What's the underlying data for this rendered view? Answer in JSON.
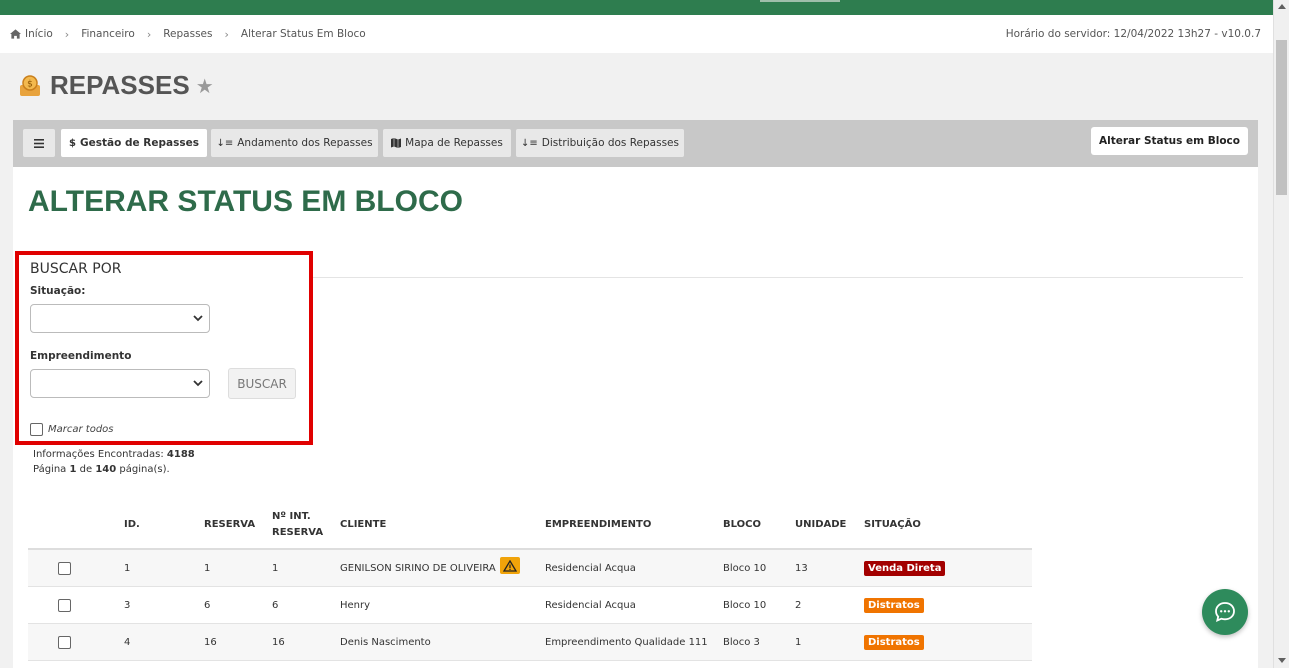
{
  "breadcrumb": {
    "items": [
      "Início",
      "Financeiro",
      "Repasses",
      "Alterar Status Em Bloco"
    ]
  },
  "server_time": "Horário do servidor: 12/04/2022 13h27 - v10.0.7",
  "page": {
    "title": "REPASSES",
    "section_title": "ALTERAR STATUS EM BLOCO"
  },
  "nav": {
    "menu_icon": "hamburger-icon",
    "tabs": [
      {
        "label": "Gestão de Repasses",
        "icon": "$"
      },
      {
        "label": "Andamento dos Repasses",
        "icon": "sort-icon"
      },
      {
        "label": "Mapa de Repasses",
        "icon": "map-icon"
      },
      {
        "label": "Distribuição dos Repasses",
        "icon": "sort-icon"
      }
    ],
    "bulk_button": "Alterar Status em Bloco"
  },
  "search": {
    "heading": "BUSCAR POR",
    "situacao_label": "Situação:",
    "situacao_value": "",
    "empreendimento_label": "Empreendimento",
    "empreendimento_value": "",
    "button": "BUSCAR",
    "mark_all": "Marcar todos"
  },
  "info": {
    "found_label": "Informações Encontradas:",
    "found_count": "4188",
    "page_prefix": "Página",
    "page_current": "1",
    "page_of": "de",
    "page_total": "140",
    "page_suffix": "página(s)."
  },
  "table": {
    "headers": {
      "id": "ID.",
      "reserva": "RESERVA",
      "int_reserva_1": "Nº INT.",
      "int_reserva_2": "RESERVA",
      "cliente": "CLIENTE",
      "empreendimento": "EMPREENDIMENTO",
      "bloco": "BLOCO",
      "unidade": "UNIDADE",
      "situacao": "SITUAÇÃO"
    },
    "rows": [
      {
        "id": "1",
        "reserva": "1",
        "int_reserva": "1",
        "cliente": "GENILSON SIRINO DE OLIVEIRA",
        "empreendimento": "Residencial Acqua",
        "bloco": "Bloco 10",
        "unidade": "13",
        "situacao": "Venda Direta",
        "situacao_color": "#a30000"
      },
      {
        "id": "3",
        "reserva": "6",
        "int_reserva": "6",
        "cliente": "Henry",
        "empreendimento": "Residencial Acqua",
        "bloco": "Bloco 10",
        "unidade": "2",
        "situacao": "Distratos",
        "situacao_color": "#f07400"
      },
      {
        "id": "4",
        "reserva": "16",
        "int_reserva": "16",
        "cliente": "Denis Nascimento",
        "empreendimento": "Empreendimento Qualidade 111",
        "bloco": "Bloco 3",
        "unidade": "1",
        "situacao": "Distratos",
        "situacao_color": "#f07400"
      }
    ]
  },
  "colors": {
    "brand_green": "#2e7d4f",
    "title_green": "#2e6b4a",
    "highlight_red": "#e00000"
  }
}
